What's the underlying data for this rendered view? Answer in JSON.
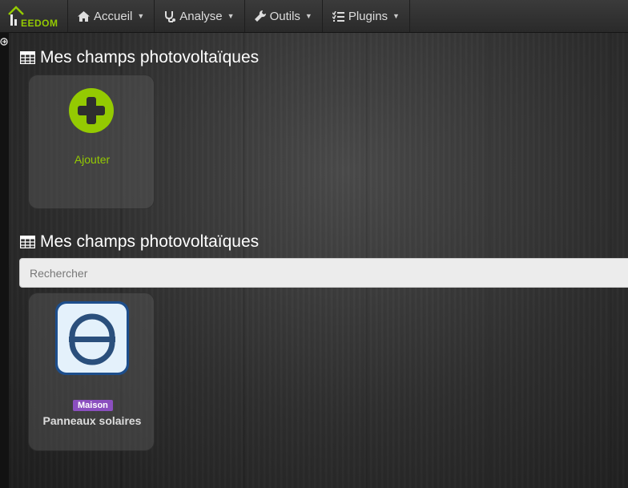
{
  "brand": {
    "text": "EEDOM",
    "color": "#94ca02"
  },
  "nav": [
    {
      "label": "Accueil",
      "icon": "home-icon"
    },
    {
      "label": "Analyse",
      "icon": "stethoscope-icon"
    },
    {
      "label": "Outils",
      "icon": "wrench-icon"
    },
    {
      "label": "Plugins",
      "icon": "tasks-icon"
    }
  ],
  "sections": {
    "management_title": "Mes champs photovoltaïques",
    "equipment_title": "Mes champs photovoltaïques"
  },
  "add_card": {
    "label": "Ajouter",
    "accent": "#94ca02"
  },
  "search": {
    "placeholder": "Rechercher",
    "value": ""
  },
  "equipment": [
    {
      "name": "Panneaux solaires",
      "object_badge": "Maison",
      "badge_color": "#8b4fbf",
      "icon": "solar-plugin-icon"
    }
  ]
}
